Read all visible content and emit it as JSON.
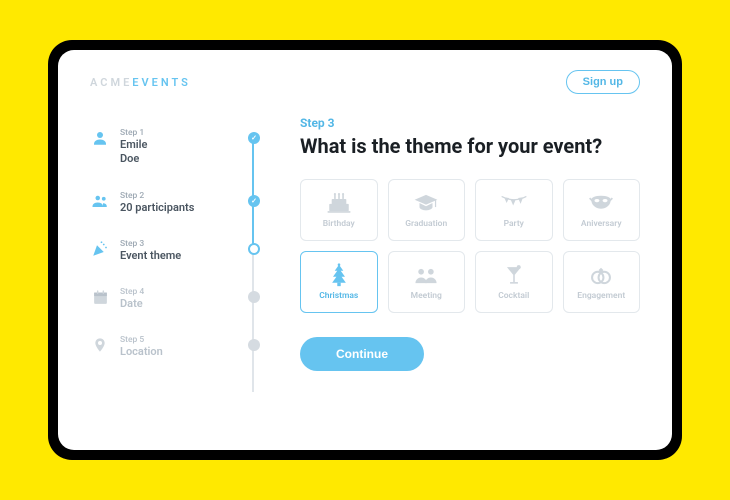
{
  "brand": {
    "part1": "ACME",
    "part2": "EVENTS"
  },
  "header": {
    "signup": "Sign up"
  },
  "sidebar": {
    "steps": [
      {
        "label": "Step 1",
        "value": "Emile\nDoe",
        "state": "done",
        "icon": "user"
      },
      {
        "label": "Step 2",
        "value": "20 participants",
        "state": "done",
        "icon": "group"
      },
      {
        "label": "Step 3",
        "value": "Event theme",
        "state": "current",
        "icon": "confetti"
      },
      {
        "label": "Step 4",
        "value": "Date",
        "state": "future",
        "icon": "calendar"
      },
      {
        "label": "Step 5",
        "value": "Location",
        "state": "future",
        "icon": "pin"
      }
    ]
  },
  "main": {
    "step_tag": "Step 3",
    "question": "What is the theme for your event?",
    "themes": [
      {
        "label": "Birthday",
        "icon": "cake",
        "selected": false
      },
      {
        "label": "Graduation",
        "icon": "gradcap",
        "selected": false
      },
      {
        "label": "Party",
        "icon": "bunting",
        "selected": false
      },
      {
        "label": "Aniversary",
        "icon": "mask",
        "selected": false
      },
      {
        "label": "Christmas",
        "icon": "tree",
        "selected": true
      },
      {
        "label": "Meeting",
        "icon": "meeting",
        "selected": false
      },
      {
        "label": "Cocktail",
        "icon": "cocktail",
        "selected": false
      },
      {
        "label": "Engagement",
        "icon": "rings",
        "selected": false
      }
    ],
    "continue": "Continue"
  },
  "colors": {
    "accent": "#66c4f0",
    "muted": "#c3cbd3"
  }
}
